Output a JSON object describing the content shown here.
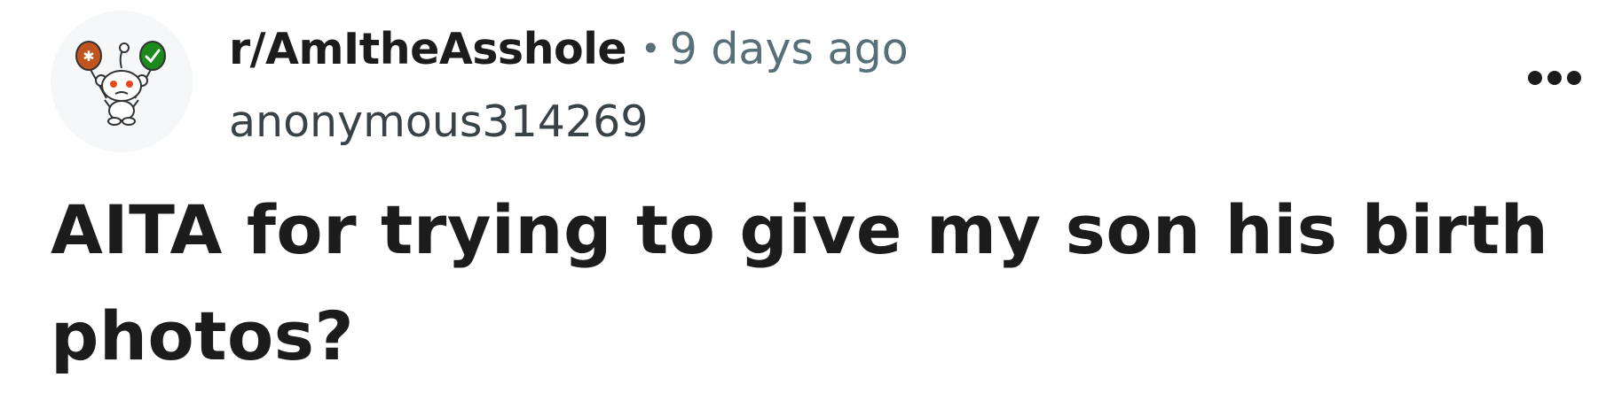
{
  "post": {
    "subreddit": "r/AmItheAsshole",
    "separator": "•",
    "time_ago": "9 days ago",
    "author": "anonymous314269",
    "title": "AITA for trying to give my son his birth photos?"
  },
  "icons": {
    "avatar": "reddit-snoo-with-balloons-icon",
    "more": "more-horizontal-icon"
  },
  "colors": {
    "balloon_left": "#c0541e",
    "balloon_right": "#1b8a1b",
    "meta_gray": "#576f76",
    "text_dark": "#1c1c1c"
  }
}
